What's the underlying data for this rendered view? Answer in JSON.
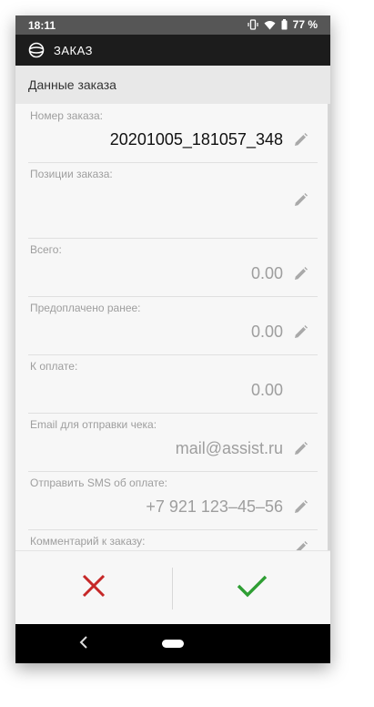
{
  "status_bar": {
    "time": "18:11",
    "battery": "77 %"
  },
  "app_bar": {
    "title": "ЗАКАЗ",
    "logo_icon": "assist-logo-icon"
  },
  "section": {
    "title": "Данные заказа"
  },
  "fields": [
    {
      "label": "Номер заказа:",
      "value": "20201005_181057_348",
      "editable": true
    },
    {
      "label": "Позиции заказа:",
      "value": "",
      "editable": true
    },
    {
      "label": "Всего:",
      "value": "0.00",
      "editable": true
    },
    {
      "label": "Предоплачено ранее:",
      "value": "0.00",
      "editable": true
    },
    {
      "label": "К оплате:",
      "value": "0.00",
      "editable": false
    },
    {
      "label": "Email для отправки чека:",
      "value": "mail@assist.ru",
      "editable": true
    },
    {
      "label": "Отправить SMS об оплате:",
      "value": "+7 921 123–45–56",
      "editable": true
    },
    {
      "label": "Комментарий к заказу:",
      "value": "",
      "editable": true
    }
  ],
  "actions": {
    "cancel_icon": "close-icon",
    "confirm_icon": "check-icon",
    "cancel_color": "#c62828",
    "confirm_color": "#2e9e33"
  },
  "nav_bar": {
    "back_icon": "back-icon",
    "home_icon": "home-pill-icon"
  }
}
